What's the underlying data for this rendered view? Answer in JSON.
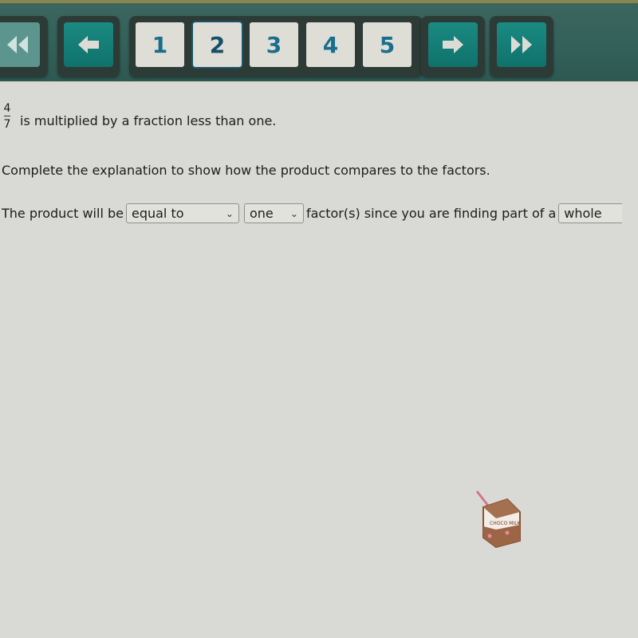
{
  "navigation": {
    "first_label": "First",
    "prev_label": "Previous",
    "next_label": "Next",
    "last_label": "Last",
    "pages": [
      "1",
      "2",
      "3",
      "4",
      "5"
    ],
    "current_page": "2",
    "colors": {
      "teal": "#0f726b",
      "page_text": "#1a6e8d",
      "bar": "#33605a"
    }
  },
  "question": {
    "fraction_numerator": "4",
    "fraction_denominator": "7",
    "statement": "is multiplied by a fraction less than one.",
    "instruction": "Complete the explanation to show how the product compares to the factors.",
    "sentence_start": "The product will be",
    "dropdown1_value": "equal to",
    "dropdown2_value": "one",
    "sentence_middle": "factor(s) since you are finding part of a",
    "dropdown3_value": "whole"
  },
  "sticker": {
    "label": "CHOCO MILK"
  }
}
